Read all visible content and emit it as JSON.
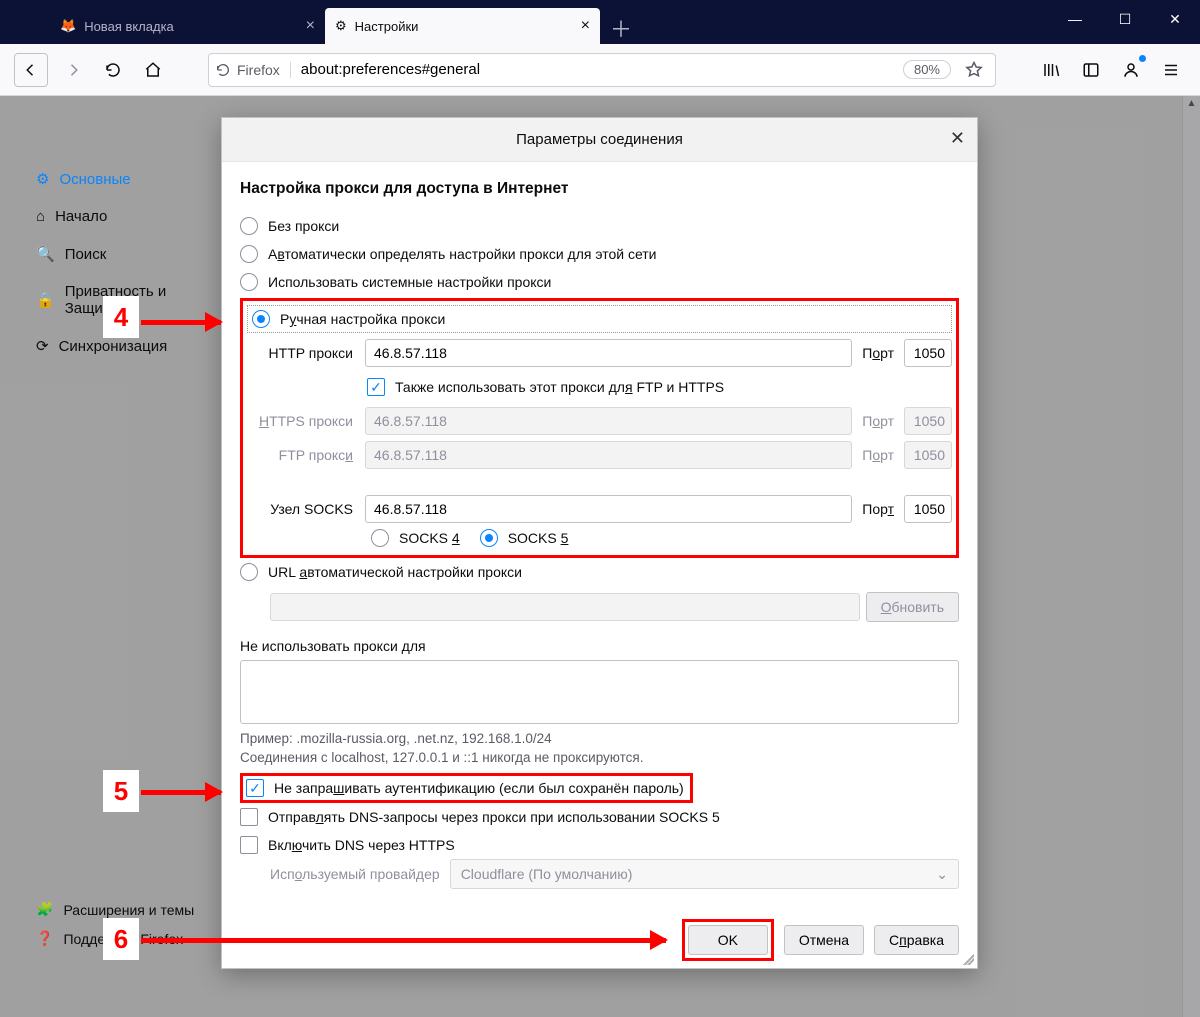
{
  "window": {
    "tabs": [
      {
        "label": "Новая вкладка",
        "active": false
      },
      {
        "label": "Настройки",
        "active": true
      }
    ],
    "url": "about:preferences#general",
    "identity": "Firefox",
    "zoom": "80%"
  },
  "sidebar": {
    "items": [
      {
        "label": "Основные",
        "icon": "gear-icon",
        "active": true
      },
      {
        "label": "Начало",
        "icon": "home-icon"
      },
      {
        "label": "Поиск",
        "icon": "search-icon"
      },
      {
        "label": "Приватность и Защита",
        "icon": "lock-icon"
      },
      {
        "label": "Синхронизация",
        "icon": "sync-icon"
      }
    ],
    "footer": [
      {
        "label": "Расширения и темы",
        "icon": "puzzle-icon"
      },
      {
        "label": "Поддержка Firefox",
        "icon": "help-icon"
      }
    ]
  },
  "modal": {
    "title": "Параметры соединения",
    "heading": "Настройка прокси для доступа в Интернет",
    "radios": {
      "no_proxy": "Без прокси",
      "auto_detect": "Автоматически определять настройки прокси для этой сети",
      "system": "Использовать системные настройки прокси",
      "manual": "Ручная настройка прокси",
      "pac": "URL автоматической настройки прокси"
    },
    "fields": {
      "http_label": "HTTP прокси",
      "http_value": "46.8.57.118",
      "http_port": "1050",
      "same_for_all": "Также использовать этот прокси для FTP и HTTPS",
      "https_label": "HTTPS прокси",
      "https_value": "46.8.57.118",
      "https_port": "1050",
      "ftp_label": "FTP прокси",
      "ftp_value": "46.8.57.118",
      "ftp_port": "1050",
      "socks_label": "Узел SOCKS",
      "socks_value": "46.8.57.118",
      "socks_port": "1050",
      "socks4": "SOCKS 4",
      "socks5": "SOCKS 5",
      "port_label": "Порт"
    },
    "pac": {
      "reload": "Обновить"
    },
    "noproxy": {
      "label": "Не использовать прокси для",
      "example": "Пример: .mozilla-russia.org, .net.nz, 192.168.1.0/24",
      "note": "Соединения с localhost, 127.0.0.1 и ::1 никогда не проксируются."
    },
    "checks": {
      "no_auth": "Не запрашивать аутентификацию (если был сохранён пароль)",
      "socks_dns": "Отправлять DNS-запросы через прокси при использовании SOCKS 5",
      "doh": "Включить DNS через HTTPS"
    },
    "provider": {
      "label": "Используемый провайдер",
      "value": "Cloudflare (По умолчанию)"
    },
    "buttons": {
      "ok": "OK",
      "cancel": "Отмена",
      "help": "Справка"
    }
  },
  "annotations": {
    "n4": "4",
    "n5": "5",
    "n6": "6"
  }
}
